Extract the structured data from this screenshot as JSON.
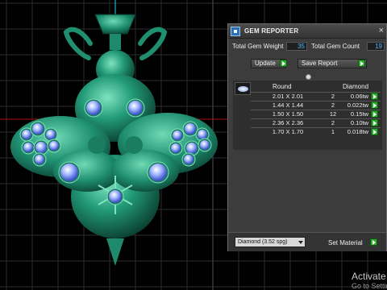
{
  "viewport": {
    "model": "bee-pendant",
    "colors": {
      "body": "#1f8f70",
      "highlight": "#6fd9b4",
      "shadow": "#0a3a2c",
      "gem": "#8fa8ff",
      "grid": "#3a3a3a"
    }
  },
  "panel": {
    "title": "GEM REPORTER",
    "close_icon": "×",
    "total_weight_label": "Total Gem Weight",
    "total_weight_value": "35",
    "total_count_label": "Total Gem Count",
    "total_count_value": "19",
    "update_label": "Update",
    "save_report_label": "Save Report",
    "table": {
      "shape_header": "Round",
      "material_header": "Diamond",
      "rows": [
        {
          "size": "2.01 X 2.01",
          "count": "2",
          "weight": "0.06tw"
        },
        {
          "size": "1.44 X 1.44",
          "count": "2",
          "weight": "0.022tw"
        },
        {
          "size": "1.50 X 1.50",
          "count": "12",
          "weight": "0.15tw"
        },
        {
          "size": "2.36 X 2.36",
          "count": "2",
          "weight": "0.10tw"
        },
        {
          "size": "1.70 X 1.70",
          "count": "1",
          "weight": "0.018tw"
        }
      ]
    },
    "material_select": "Diamond      (3.52 spg)",
    "set_material_label": "Set Material"
  },
  "watermark": {
    "line1": "Activate",
    "line2": "Go to Settings"
  }
}
